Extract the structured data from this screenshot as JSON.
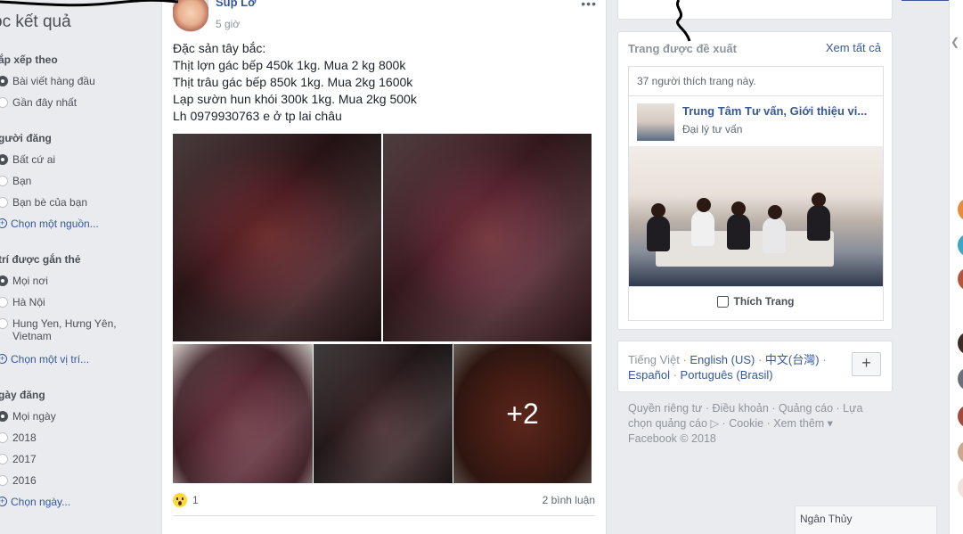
{
  "filters": {
    "title": "ọc kết quả",
    "sort": {
      "label": "ắp xếp theo",
      "options": [
        {
          "label": "Bài viết hàng đầu",
          "selected": true
        },
        {
          "label": "Gần đây nhất",
          "selected": false
        }
      ]
    },
    "poster": {
      "label": "gười đăng",
      "options": [
        {
          "label": "Bất cứ ai",
          "selected": true
        },
        {
          "label": "Bạn",
          "selected": false
        },
        {
          "label": "Bạn bè của bạn",
          "selected": false
        }
      ],
      "choose": "Chọn một nguồn..."
    },
    "location": {
      "label": "trí được gắn thẻ",
      "options": [
        {
          "label": "Mọi nơi",
          "selected": true
        },
        {
          "label": "Hà Nội",
          "selected": false
        },
        {
          "label": "Hung Yen, Hưng Yên,",
          "label2": "Vietnam",
          "selected": false
        }
      ],
      "choose": "Chọn một vị trí..."
    },
    "date": {
      "label": "gày đăng",
      "options": [
        {
          "label": "Mọi ngày",
          "selected": true
        },
        {
          "label": "2018",
          "selected": false
        },
        {
          "label": "2017",
          "selected": false
        },
        {
          "label": "2016",
          "selected": false
        }
      ],
      "choose": "Chọn ngày..."
    }
  },
  "post": {
    "author": "Súp Lơ",
    "time": "5 giờ",
    "lines": [
      "Đặc sản tây bắc:",
      "Thịt lợn gác bếp 450k 1kg. Mua 2 kg 800k",
      "Thịt trâu gác bếp 850k 1kg. Mua 2kg 1600k",
      "Lạp sườn hun khói 300k 1kg. Mua 2kg 500k",
      "Lh 0979930763 e ở tp lai châu"
    ],
    "more_photos": "+2",
    "reaction_count": "1",
    "comments": "2 bình luận"
  },
  "suggested": {
    "heading": "Trang được đề xuất",
    "see_all": "Xem tất cả",
    "likes": "37 người thích trang này.",
    "page_name": "Trung Tâm Tư vấn, Giới thiệu vi...",
    "category": "Đại lý tư vấn",
    "like_button": "Thích Trang"
  },
  "languages": {
    "current": "Tiếng Việt",
    "others": [
      "English (US)",
      "中文(台灣)",
      "Español",
      "Português (Brasil)"
    ],
    "add": "+"
  },
  "footer": {
    "links": [
      "Quyền riêng tư",
      "Điều khoản",
      "Quảng cáo",
      "Lựa chọn quảng cáo",
      "Cookie",
      "Xem thêm"
    ],
    "copyright": "Facebook © 2018"
  },
  "chat": {
    "tab_name": "Ngân Thủy"
  }
}
